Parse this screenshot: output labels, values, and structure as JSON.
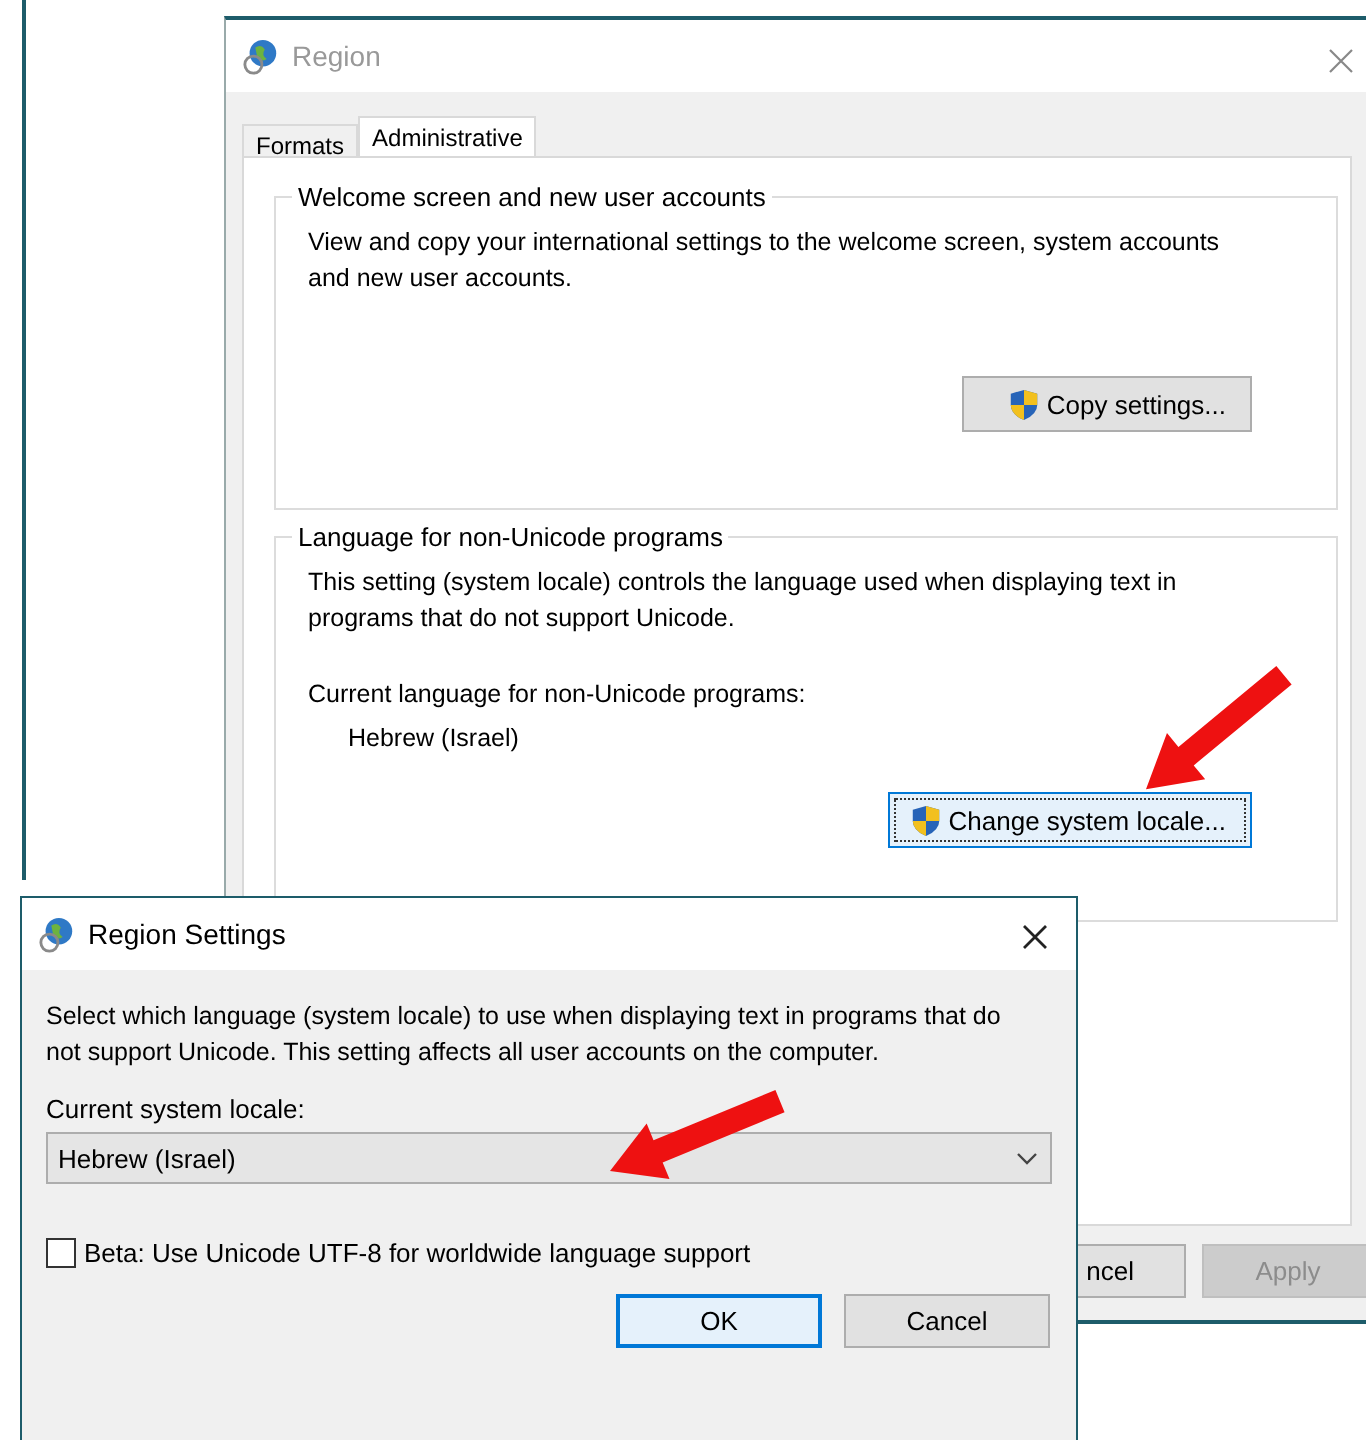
{
  "region_window": {
    "title": "Region",
    "tabs": [
      {
        "label": "Formats",
        "selected": false
      },
      {
        "label": "Administrative",
        "selected": true
      }
    ],
    "groups": [
      {
        "title": "Welcome screen and new user accounts",
        "text": "View and copy your international settings to the welcome screen, system accounts and new user accounts.",
        "button": "Copy settings...",
        "button_focused": false
      },
      {
        "title": "Language for non-Unicode programs",
        "text": "This setting (system locale) controls the language used when displaying text in programs that do not support Unicode.",
        "current_label": "Current language for non-Unicode programs:",
        "current_value": "Hebrew (Israel)",
        "button": "Change system locale...",
        "button_focused": true
      }
    ],
    "buttons": [
      {
        "label": "ncel",
        "disabled": false
      },
      {
        "label": "Apply",
        "disabled": true
      }
    ]
  },
  "region_settings_dialog": {
    "title": "Region Settings",
    "text": "Select which language (system locale) to use when displaying text in programs that do not support Unicode. This setting affects all user accounts on the computer.",
    "locale_label": "Current system locale:",
    "locale_value": "Hebrew (Israel)",
    "beta_checkbox": {
      "label": "Beta: Use Unicode UTF-8 for worldwide language support",
      "checked": false
    },
    "buttons": [
      {
        "label": "OK",
        "default": true
      },
      {
        "label": "Cancel",
        "default": false
      }
    ]
  }
}
